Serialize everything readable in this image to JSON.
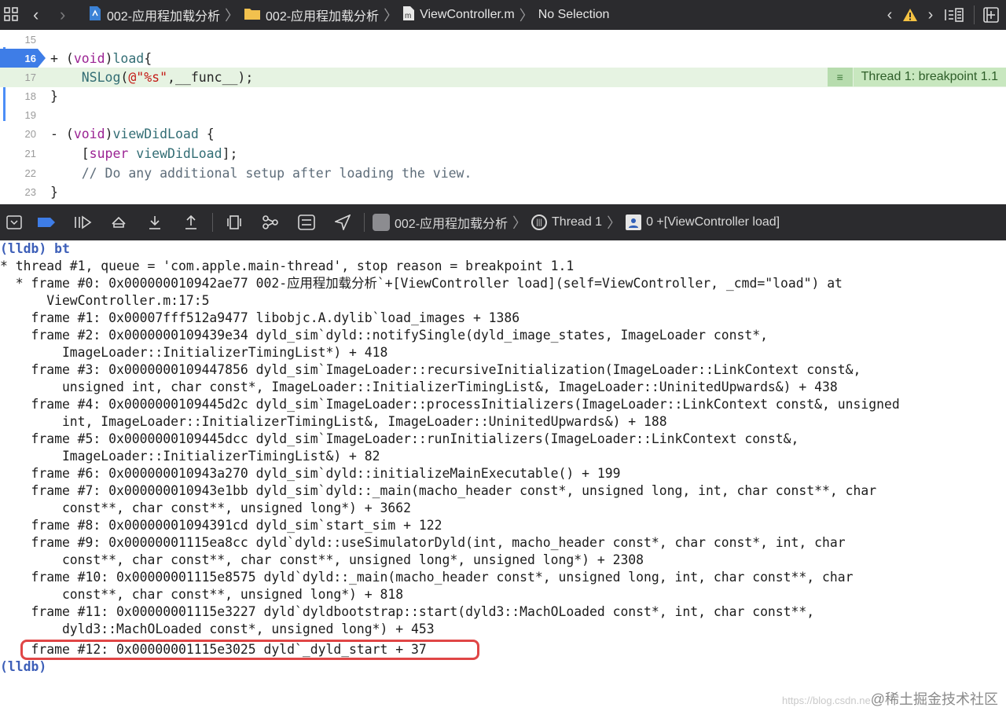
{
  "topbar": {
    "crumbs": [
      "002-应用程加载分析",
      "002-应用程加载分析",
      "ViewController.m",
      "No Selection"
    ]
  },
  "editor": {
    "lines": [
      {
        "num": "15"
      },
      {
        "num": "16",
        "text_a": "+ (",
        "text_kw": "void",
        "text_b": ")",
        "text_fn": "load",
        "text_c": "{"
      },
      {
        "num": "17",
        "text_a": "    ",
        "text_fn": "NSLog",
        "text_b": "(",
        "text_str": "@\"%s\"",
        "text_c": ",__func__);"
      },
      {
        "num": "18",
        "text_a": "}"
      },
      {
        "num": "19"
      },
      {
        "num": "20",
        "text_a": "- (",
        "text_kw": "void",
        "text_b": ")",
        "text_fn": "viewDidLoad",
        "text_c": " {"
      },
      {
        "num": "21",
        "text_a": "    [",
        "text_kw": "super",
        "text_b": " ",
        "text_fn": "viewDidLoad",
        "text_c": "];"
      },
      {
        "num": "22",
        "text_cm": "    // Do any additional setup after loading the view."
      },
      {
        "num": "23",
        "text_a": "}"
      }
    ],
    "thread_badge": "Thread 1: breakpoint 1.1"
  },
  "debugbar": {
    "path": [
      "002-应用程加载分析",
      "Thread 1",
      "0 +[ViewController load]"
    ]
  },
  "console": {
    "lines": [
      "(lldb) bt",
      "* thread #1, queue = 'com.apple.main-thread', stop reason = breakpoint 1.1",
      "  * frame #0: 0x000000010942ae77 002-应用程加载分析`+[ViewController load](self=ViewController, _cmd=\"load\") at",
      "      ViewController.m:17:5",
      "    frame #1: 0x00007fff512a9477 libobjc.A.dylib`load_images + 1386",
      "    frame #2: 0x0000000109439e34 dyld_sim`dyld::notifySingle(dyld_image_states, ImageLoader const*,",
      "        ImageLoader::InitializerTimingList*) + 418",
      "    frame #3: 0x0000000109447856 dyld_sim`ImageLoader::recursiveInitialization(ImageLoader::LinkContext const&,",
      "        unsigned int, char const*, ImageLoader::InitializerTimingList&, ImageLoader::UninitedUpwards&) + 438",
      "    frame #4: 0x0000000109445d2c dyld_sim`ImageLoader::processInitializers(ImageLoader::LinkContext const&, unsigned",
      "        int, ImageLoader::InitializerTimingList&, ImageLoader::UninitedUpwards&) + 188",
      "    frame #5: 0x0000000109445dcc dyld_sim`ImageLoader::runInitializers(ImageLoader::LinkContext const&,",
      "        ImageLoader::InitializerTimingList&) + 82",
      "    frame #6: 0x000000010943a270 dyld_sim`dyld::initializeMainExecutable() + 199",
      "    frame #7: 0x000000010943e1bb dyld_sim`dyld::_main(macho_header const*, unsigned long, int, char const**, char",
      "        const**, char const**, unsigned long*) + 3662",
      "    frame #8: 0x00000001094391cd dyld_sim`start_sim + 122",
      "    frame #9: 0x00000001115ea8cc dyld`dyld::useSimulatorDyld(int, macho_header const*, char const*, int, char",
      "        const**, char const**, char const**, unsigned long*, unsigned long*) + 2308",
      "    frame #10: 0x00000001115e8575 dyld`dyld::_main(macho_header const*, unsigned long, int, char const**, char",
      "        const**, char const**, unsigned long*) + 818",
      "    frame #11: 0x00000001115e3227 dyld`dyldbootstrap::start(dyld3::MachOLoaded const*, int, char const**,",
      "        dyld3::MachOLoaded const*, unsigned long*) + 453",
      "    frame #12: 0x00000001115e3025 dyld`_dyld_start + 37",
      "(lldb)"
    ],
    "watermark_faint": "https://blog.csdn.ne",
    "watermark": "@稀土掘金技术社区"
  }
}
